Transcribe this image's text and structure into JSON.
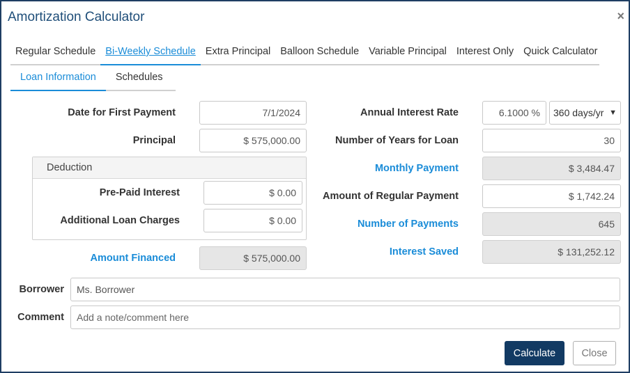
{
  "window": {
    "title": "Amortization Calculator",
    "close_glyph": "×",
    "close_icon": "close-icon"
  },
  "main_tabs": [
    {
      "label": "Regular Schedule",
      "active": false
    },
    {
      "label": "Bi-Weekly Schedule",
      "active": true
    },
    {
      "label": "Extra Principal",
      "active": false
    },
    {
      "label": "Balloon Schedule",
      "active": false
    },
    {
      "label": "Variable Principal",
      "active": false
    },
    {
      "label": "Interest Only",
      "active": false
    },
    {
      "label": "Quick Calculator",
      "active": false
    }
  ],
  "sub_tabs": [
    {
      "label": "Loan Information",
      "active": true
    },
    {
      "label": "Schedules",
      "active": false
    }
  ],
  "left": {
    "first_payment": {
      "label": "Date for First Payment",
      "value": "7/1/2024"
    },
    "principal": {
      "label": "Principal",
      "value": "$ 575,000.00"
    },
    "deduction": {
      "title": "Deduction",
      "prepaid_interest": {
        "label": "Pre-Paid Interest",
        "value": "$ 0.00"
      },
      "additional_charges": {
        "label": "Additional Loan Charges",
        "value": "$ 0.00"
      }
    },
    "amount_financed": {
      "label": "Amount Financed",
      "value": "$ 575,000.00"
    }
  },
  "right": {
    "interest_rate": {
      "label": "Annual Interest Rate",
      "value": "6.1000 %",
      "day_basis": "360 days/yr"
    },
    "years": {
      "label": "Number of Years for Loan",
      "value": "30"
    },
    "monthly_payment": {
      "label": "Monthly Payment",
      "value": "$ 3,484.47"
    },
    "regular_payment": {
      "label": "Amount of Regular Payment",
      "value": "$ 1,742.24"
    },
    "num_payments": {
      "label": "Number of Payments",
      "value": "645"
    },
    "interest_saved": {
      "label": "Interest Saved",
      "value": "$ 131,252.12"
    }
  },
  "borrower": {
    "label": "Borrower",
    "value": "Ms. Borrower"
  },
  "comment": {
    "label": "Comment",
    "placeholder": "Add a note/comment here"
  },
  "buttons": {
    "calculate": "Calculate",
    "close": "Close"
  },
  "colors": {
    "accent": "#1a8cd8",
    "primary_button": "#123a63",
    "title": "#1f4e79",
    "readonly_bg": "#e6e6e6"
  }
}
